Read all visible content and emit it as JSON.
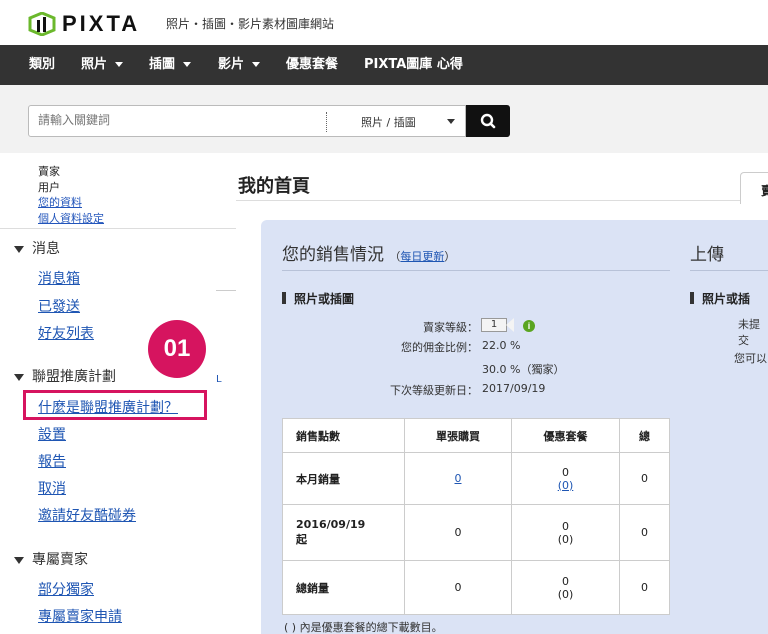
{
  "header": {
    "logo_text": "PIXTA",
    "tagline": "照片・插圖・影片素材圖庫網站"
  },
  "nav": {
    "items": [
      {
        "label": "類別",
        "dropdown": false
      },
      {
        "label": "照片",
        "dropdown": true
      },
      {
        "label": "插圖",
        "dropdown": true
      },
      {
        "label": "影片",
        "dropdown": true
      },
      {
        "label": "優惠套餐",
        "dropdown": false
      },
      {
        "label": "PIXTA圖庫 心得",
        "dropdown": false
      }
    ]
  },
  "search": {
    "placeholder": "請輸入關鍵詞",
    "category": "照片 / 插圖"
  },
  "sidebar": {
    "account": {
      "role": "賣家",
      "user": "用户",
      "profile_link": "您的資料",
      "settings_link": "個人資料設定"
    },
    "sections": [
      {
        "title": "消息",
        "links": [
          "消息箱",
          "已發送",
          "好友列表"
        ]
      },
      {
        "title": "聯盟推廣計劃",
        "links": [
          "什麼是聯盟推廣計劃？",
          "設置",
          "報告",
          "取消",
          "邀請好友酷碰券"
        ]
      },
      {
        "title": "專屬賣家",
        "links": [
          "部分獨家",
          "專屬賣家申請"
        ]
      }
    ],
    "edge_mark": "L",
    "step_badge": "01"
  },
  "main": {
    "title": "我的首頁",
    "tab_label": "賣",
    "sales": {
      "title": "您的銷售情況",
      "update_open": "（",
      "update_link": "每日更新",
      "update_close": "）",
      "subheading": "照片或插圖",
      "level_label": "賣家等級：",
      "level_value": "1",
      "commission_label": "您的佣金比例：",
      "commission_value": "22.0 %",
      "exclusive_value": "30.0 %（獨家）",
      "next_update_label": "下次等級更新日：",
      "next_update_value": "2017/09/19",
      "table": {
        "headers": [
          "銷售點數",
          "單張購買",
          "優惠套餐",
          "總"
        ],
        "rows": [
          {
            "label": "本月銷量",
            "label_sub": "",
            "single": "0",
            "pack": "0",
            "pack_sub": "(0)",
            "total": "0"
          },
          {
            "label": "2016/09/19",
            "label_sub": "起",
            "single": "0",
            "pack": "0",
            "pack_sub": "(0)",
            "total": "0"
          },
          {
            "label": "總銷量",
            "label_sub": "",
            "single": "0",
            "pack": "0",
            "pack_sub": "(0)",
            "total": "0"
          }
        ]
      },
      "note": "( ) 內是優惠套餐的總下載數目。"
    },
    "upload": {
      "title": "上傳",
      "subheading": "照片或插",
      "line1": "未提交",
      "line2": "您可以"
    }
  },
  "colors": {
    "accent": "#d6145f",
    "nav_bg": "#333333",
    "panel_bg": "#dbe3f5",
    "link": "#1f56b3"
  }
}
